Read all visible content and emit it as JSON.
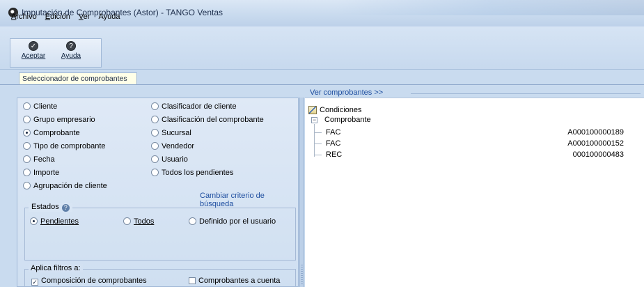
{
  "window": {
    "title": "Imputación de Comprobantes (Astor) - TANGO Ventas"
  },
  "menu": {
    "items": [
      {
        "underline": "A",
        "rest": "rchivo"
      },
      {
        "underline": "E",
        "rest": "dición"
      },
      {
        "underline": "V",
        "rest": "er"
      },
      {
        "underline": "",
        "rest": "Ayuda"
      }
    ]
  },
  "toolbar": {
    "aceptar_label": "Aceptar",
    "ayuda_label": "Ayuda",
    "aceptar_icon": "check-icon",
    "ayuda_icon": "help-icon"
  },
  "tabs": {
    "active": "Seleccionador de comprobantes"
  },
  "criteria": {
    "left_column": [
      {
        "label": "Cliente",
        "selected": false
      },
      {
        "label": "Grupo empresario",
        "selected": false
      },
      {
        "label": "Comprobante",
        "selected": true
      },
      {
        "label": "Tipo de comprobante",
        "selected": false
      },
      {
        "label": "Fecha",
        "selected": false
      },
      {
        "label": "Importe",
        "selected": false
      },
      {
        "label": "Agrupación de cliente",
        "selected": false
      }
    ],
    "right_column": [
      {
        "label": "Clasificador de cliente",
        "selected": false
      },
      {
        "label": "Clasificación del comprobante",
        "selected": false
      },
      {
        "label": "Sucursal",
        "selected": false
      },
      {
        "label": "Vendedor",
        "selected": false
      },
      {
        "label": "Usuario",
        "selected": false
      },
      {
        "label": "Todos los pendientes",
        "selected": false
      }
    ],
    "change_link": "Cambiar criterio de búsqueda"
  },
  "estados": {
    "legend": "Estados",
    "options": [
      {
        "label": "Pendientes",
        "selected": true
      },
      {
        "label": "Todos",
        "selected": false
      },
      {
        "label": "Definido por el usuario",
        "selected": false
      }
    ]
  },
  "filtros": {
    "legend": "Aplica filtros a:",
    "options": [
      {
        "label": "Composición de comprobantes",
        "checked": true
      },
      {
        "label": "Comprobantes a cuenta",
        "checked": false
      }
    ]
  },
  "right_panel": {
    "header_link": "Ver comprobantes >>",
    "root": "Condiciones",
    "group": "Comprobante",
    "rows": [
      {
        "type": "FAC",
        "number": "A000100000189"
      },
      {
        "type": "FAC",
        "number": "A000100000152"
      },
      {
        "type": "REC",
        "number": "000100000483"
      }
    ]
  }
}
